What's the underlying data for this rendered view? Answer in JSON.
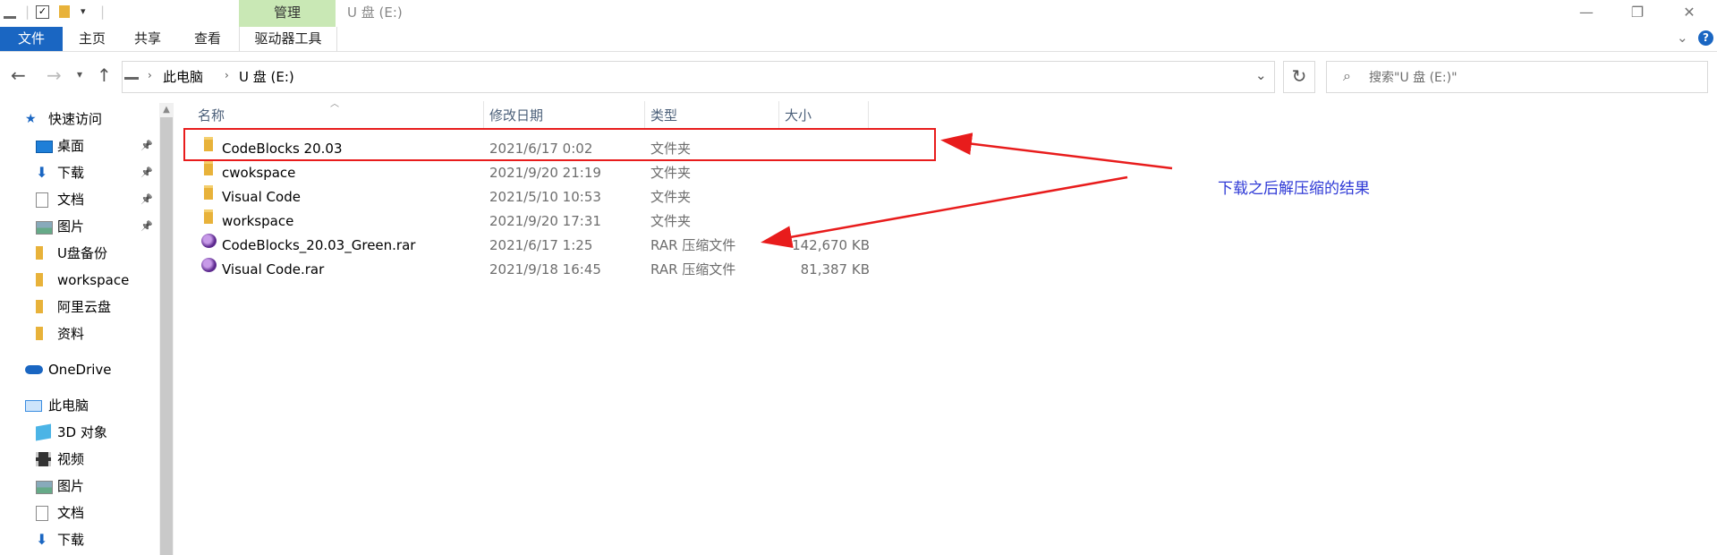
{
  "window": {
    "title": "U 盘 (E:)",
    "context_tab": "管理",
    "buttons": {
      "minimize": "—",
      "restore": "❐",
      "close": "✕"
    }
  },
  "ribbon": {
    "tabs": [
      "文件",
      "主页",
      "共享",
      "查看",
      "驱动器工具"
    ],
    "collapse_icon": "chevron-down-icon",
    "help_icon": "help-icon"
  },
  "address": {
    "breadcrumb": [
      "此电脑",
      "U 盘 (E:)"
    ],
    "search_placeholder": "搜索\"U 盘 (E:)\""
  },
  "sidebar": {
    "items": [
      {
        "label": "快速访问",
        "icon": "star-icon",
        "pinned": false,
        "indent": 1
      },
      {
        "label": "桌面",
        "icon": "desktop-icon",
        "pinned": true,
        "indent": 2
      },
      {
        "label": "下载",
        "icon": "download-icon",
        "pinned": true,
        "indent": 2
      },
      {
        "label": "文档",
        "icon": "document-icon",
        "pinned": true,
        "indent": 2
      },
      {
        "label": "图片",
        "icon": "picture-icon",
        "pinned": true,
        "indent": 2
      },
      {
        "label": "U盘备份",
        "icon": "folder-icon",
        "pinned": false,
        "indent": 2
      },
      {
        "label": "workspace",
        "icon": "folder-icon",
        "pinned": false,
        "indent": 2
      },
      {
        "label": "阿里云盘",
        "icon": "folder-icon",
        "pinned": false,
        "indent": 2
      },
      {
        "label": "资料",
        "icon": "folder-icon",
        "pinned": false,
        "indent": 2
      },
      {
        "label": "OneDrive",
        "icon": "cloud-icon",
        "pinned": false,
        "indent": 1
      },
      {
        "label": "此电脑",
        "icon": "computer-icon",
        "pinned": false,
        "indent": 1
      },
      {
        "label": "3D 对象",
        "icon": "cube-icon",
        "pinned": false,
        "indent": 2
      },
      {
        "label": "视频",
        "icon": "video-icon",
        "pinned": false,
        "indent": 2
      },
      {
        "label": "图片",
        "icon": "picture-icon",
        "pinned": false,
        "indent": 2
      },
      {
        "label": "文档",
        "icon": "document-icon",
        "pinned": false,
        "indent": 2
      },
      {
        "label": "下载",
        "icon": "download-icon",
        "pinned": false,
        "indent": 2
      }
    ]
  },
  "files": {
    "columns": [
      "名称",
      "修改日期",
      "类型",
      "大小"
    ],
    "rows": [
      {
        "name": "CodeBlocks 20.03",
        "date": "2021/6/17 0:02",
        "type": "文件夹",
        "size": "",
        "icon": "folder-icon"
      },
      {
        "name": "cwokspace",
        "date": "2021/9/20 21:19",
        "type": "文件夹",
        "size": "",
        "icon": "folder-icon"
      },
      {
        "name": "Visual Code",
        "date": "2021/5/10 10:53",
        "type": "文件夹",
        "size": "",
        "icon": "folder-icon"
      },
      {
        "name": "workspace",
        "date": "2021/9/20 17:31",
        "type": "文件夹",
        "size": "",
        "icon": "folder-icon"
      },
      {
        "name": "CodeBlocks_20.03_Green.rar",
        "date": "2021/6/17 1:25",
        "type": "RAR 压缩文件",
        "size": "142,670 KB",
        "icon": "rar-archive-icon"
      },
      {
        "name": "Visual Code.rar",
        "date": "2021/9/18 16:45",
        "type": "RAR 压缩文件",
        "size": "81,387 KB",
        "icon": "rar-archive-icon"
      }
    ]
  },
  "annotation": {
    "text": "下载之后解压缩的结果",
    "color": "#e81c1c"
  }
}
